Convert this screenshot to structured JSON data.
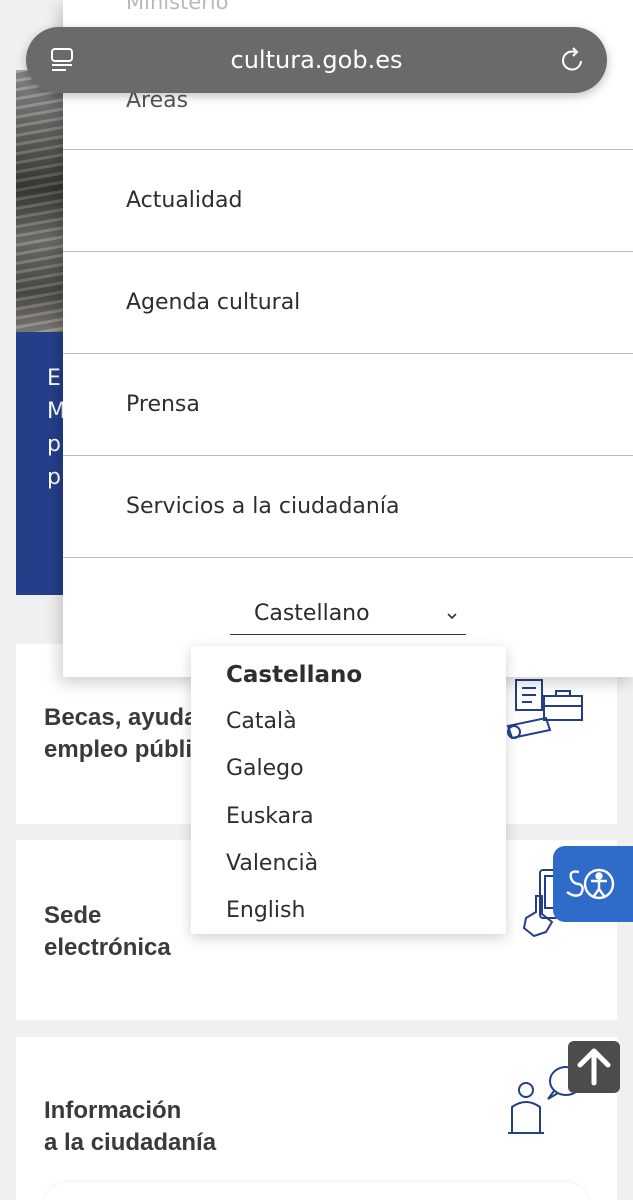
{
  "browser": {
    "url": "cultura.gob.es",
    "menu_icon": "reader-icon",
    "reload_icon": "reload-icon"
  },
  "menu": {
    "top_item_faded": "Ministerio",
    "items": [
      {
        "label": "Áreas"
      },
      {
        "label": "Actualidad"
      },
      {
        "label": "Agenda cultural"
      },
      {
        "label": "Prensa"
      },
      {
        "label": "Servicios a la ciudadanía"
      }
    ]
  },
  "language": {
    "selected": "Castellano",
    "options": [
      "Castellano",
      "Català",
      "Galego",
      "Euskara",
      "Valencià",
      "English"
    ]
  },
  "background": {
    "hero_text_fragments": [
      "E",
      "M",
      "p",
      "p"
    ],
    "cards": [
      {
        "title_line1": "Becas, ayudas y",
        "title_line2": "empleo público"
      },
      {
        "title_line1": "Sede",
        "title_line2": "electrónica"
      },
      {
        "title_line1": "Información",
        "title_line2": "a la ciudadanía"
      }
    ]
  },
  "colors": {
    "accent_blue": "#243f8a",
    "accessibility_button": "#2f6cc9",
    "scroll_top_button": "#4c4c4c"
  }
}
